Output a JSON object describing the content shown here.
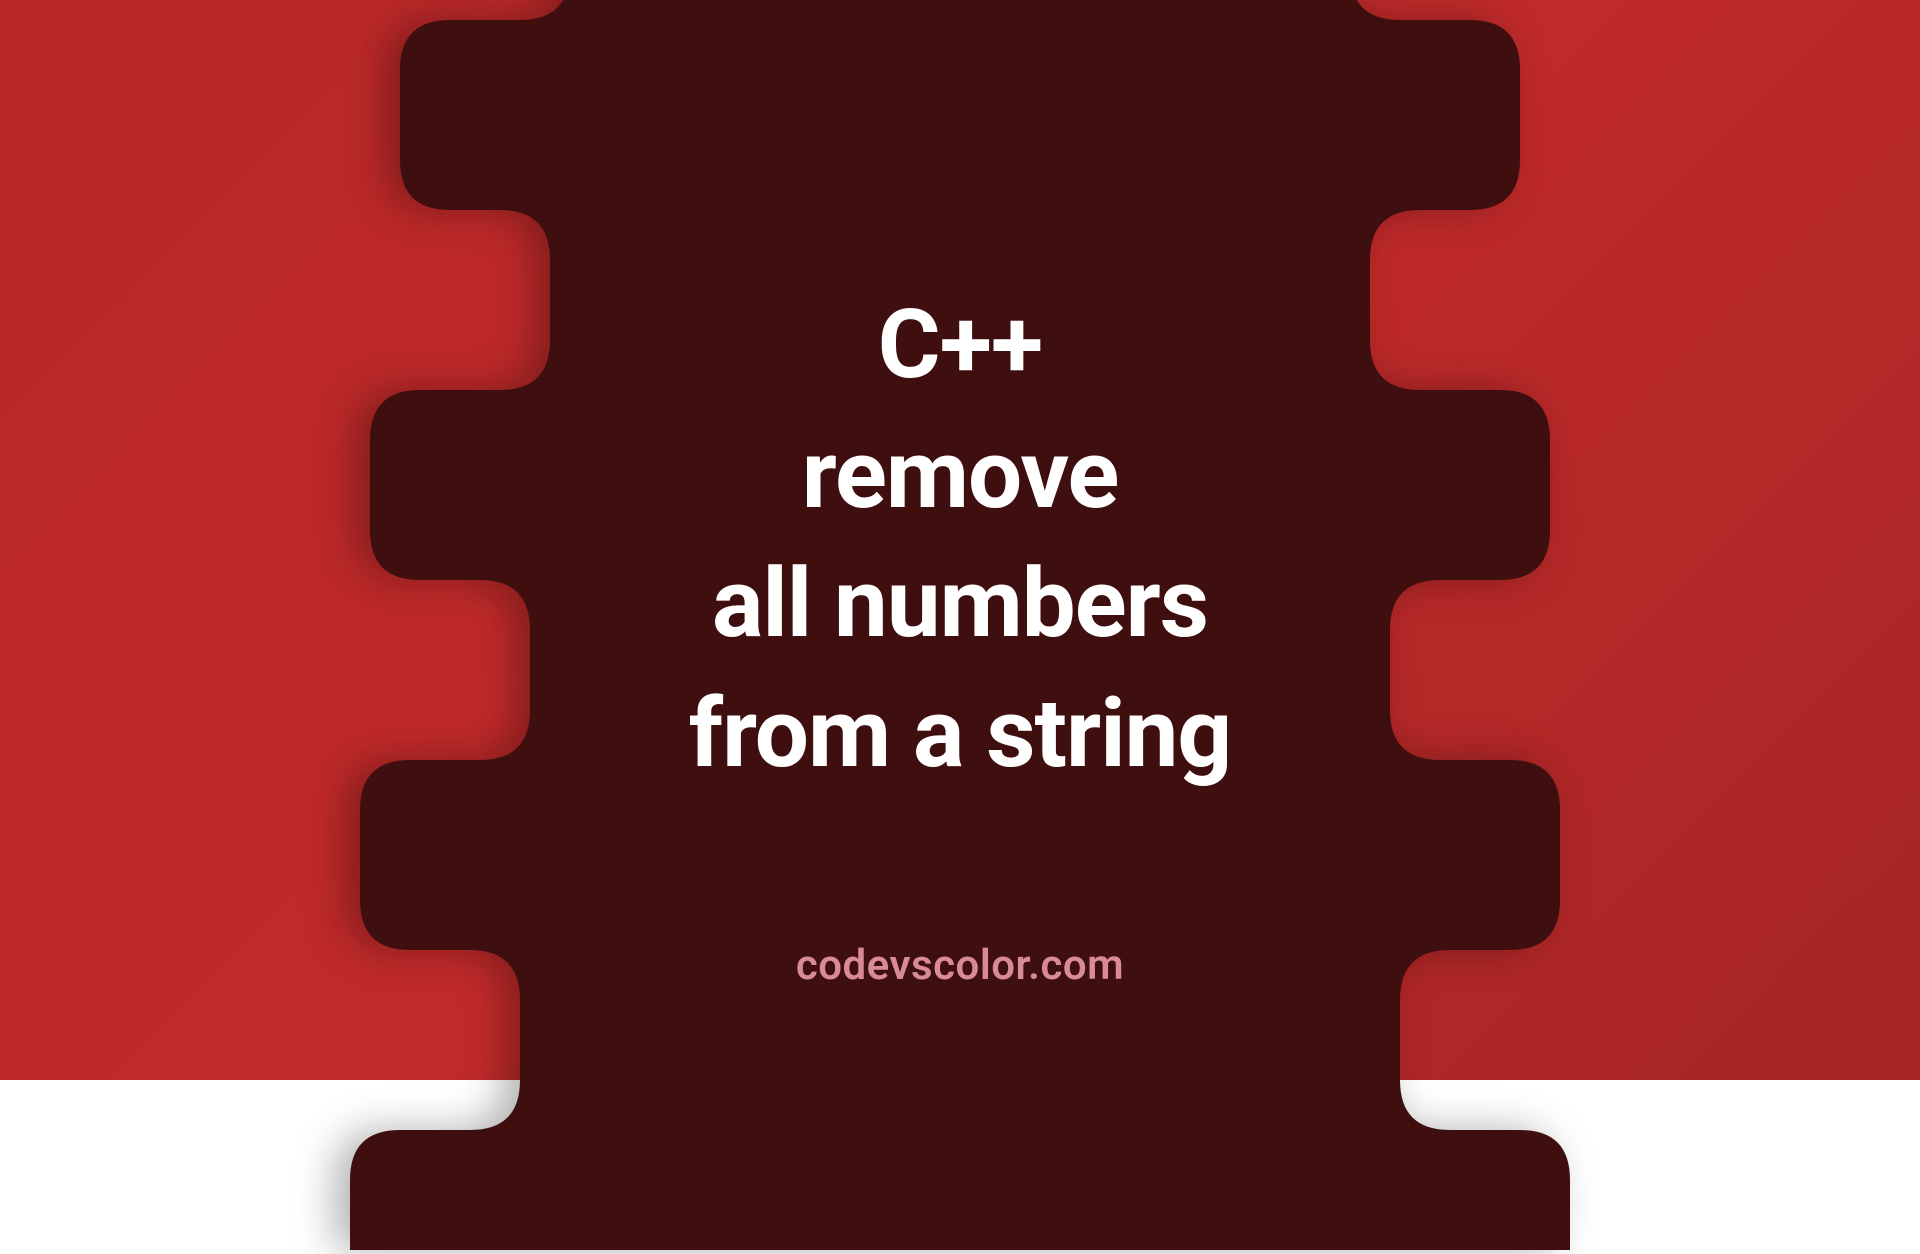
{
  "title": {
    "line1": "C++",
    "line2": "remove",
    "line3": "all numbers",
    "line4": "from a string"
  },
  "website": "codevscolor.com",
  "colors": {
    "background_red": "#b82827",
    "blob_dark": "#3f0e0e",
    "text_primary": "#ffffff",
    "text_secondary": "#d88b95"
  }
}
